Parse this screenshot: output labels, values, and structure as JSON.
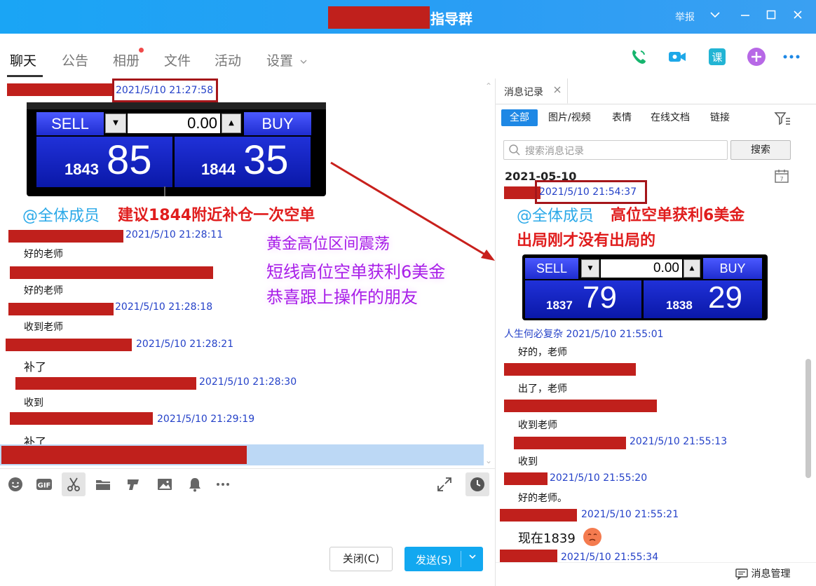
{
  "window": {
    "title": "指导群",
    "report_label": "举报"
  },
  "tabs": [
    {
      "label": "聊天"
    },
    {
      "label": "公告"
    },
    {
      "label": "相册"
    },
    {
      "label": "文件"
    },
    {
      "label": "活动"
    },
    {
      "label": "设置"
    }
  ],
  "chat": {
    "first_timestamp": "2021/5/10 21:27:58",
    "widget": {
      "sell_label": "SELL",
      "buy_label": "BUY",
      "volume": "0.00",
      "sell_small": "1843",
      "sell_large": "85",
      "buy_small": "1844",
      "buy_large": "35"
    },
    "announcement_at": "@全体成员",
    "announcement_text": "建议1844附近补仓一次空单",
    "overlay_lines": [
      "黄金高位区间震荡",
      "短线高位空单获利6美金",
      "恭喜跟上操作的朋友"
    ],
    "messages": [
      {
        "time": "2021/5/10 21:28:11",
        "text": "好的老师"
      },
      {
        "time": "",
        "text": "好的老师"
      },
      {
        "time": "2021/5/10 21:28:18",
        "text": "收到老师"
      },
      {
        "time": "2021/5/10 21:28:21",
        "text": "补了"
      },
      {
        "time": "2021/5/10 21:28:30",
        "text": "收到"
      },
      {
        "time": "2021/5/10 21:29:19",
        "text": "补了"
      }
    ]
  },
  "composer": {
    "close_label": "关闭(C)",
    "send_label": "发送(S)"
  },
  "history": {
    "tab_label": "消息记录",
    "filters": [
      "全部",
      "图片/视频",
      "表情",
      "在线文档",
      "链接"
    ],
    "search_placeholder": "搜索消息记录",
    "search_button": "搜索",
    "date": "2021-05-10",
    "first_timestamp": "2021/5/10 21:54:37",
    "announcement_at": "@全体成员",
    "announcement_line1": "高位空单获利6美金",
    "announcement_line2": "出局刚才没有出局的",
    "widget": {
      "sell_label": "SELL",
      "buy_label": "BUY",
      "volume": "0.00",
      "sell_small": "1837",
      "sell_large": "79",
      "buy_small": "1838",
      "buy_large": "29"
    },
    "messages": [
      {
        "sender": "人生何必复杂",
        "time": "2021/5/10 21:55:01",
        "text": "好的，老师"
      },
      {
        "sender": "",
        "time": "",
        "text": "出了，老师"
      },
      {
        "sender": "",
        "time": "",
        "text": "收到老师"
      },
      {
        "sender": "",
        "time": "2021/5/10 21:55:13",
        "text": "收到"
      },
      {
        "sender": "",
        "time": "2021/5/10 21:55:20",
        "text": "好的老师。"
      },
      {
        "sender": "",
        "time": "2021/5/10 21:55:21",
        "text": "现在1839"
      },
      {
        "sender": "",
        "time": "2021/5/10 21:55:34",
        "text": ""
      }
    ],
    "footer_label": "消息管理"
  }
}
